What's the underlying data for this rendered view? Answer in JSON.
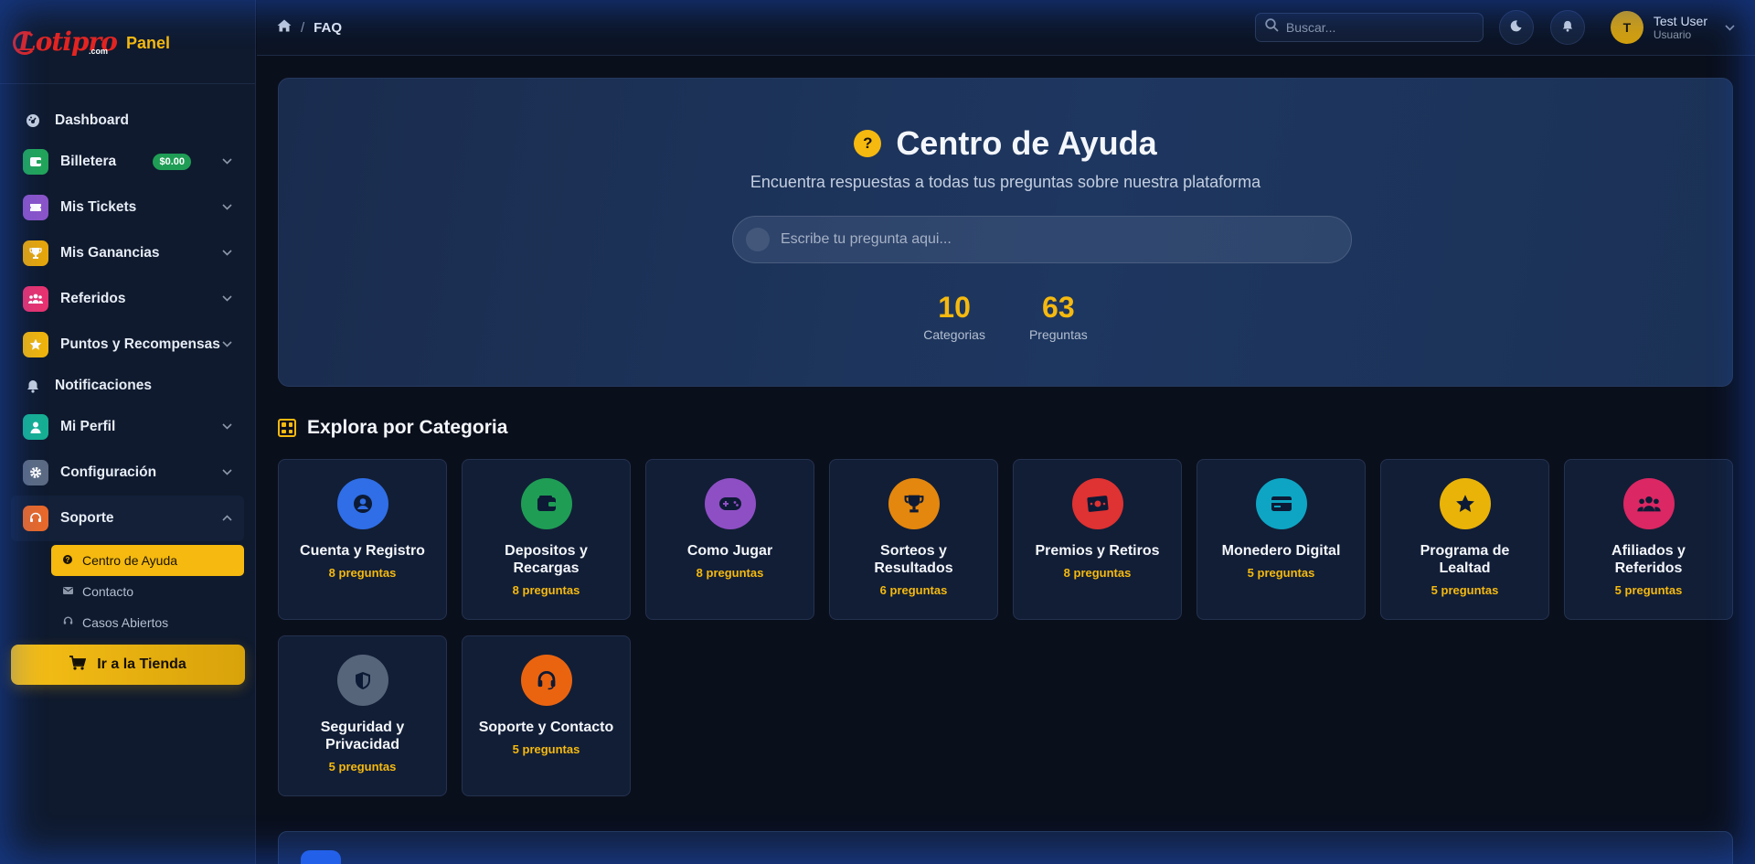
{
  "brand": {
    "logo_text": "Lotipro",
    "logo_suffix": ".com",
    "panel_label": "Panel"
  },
  "sidebar": {
    "items": [
      {
        "label": "Dashboard",
        "icon": "dashboard-icon"
      },
      {
        "label": "Billetera",
        "icon": "wallet-icon",
        "color": "#22a55a",
        "badge": "$0.00"
      },
      {
        "label": "Mis Tickets",
        "icon": "ticket-icon",
        "color": "#8b55c9"
      },
      {
        "label": "Mis Ganancias",
        "icon": "trophy-icon",
        "color": "#e6a60b"
      },
      {
        "label": "Referidos",
        "icon": "users-icon",
        "color": "#e8336f"
      },
      {
        "label": "Puntos y Recompensas",
        "icon": "star-icon",
        "color": "#f0b40c"
      },
      {
        "label": "Notificaciones",
        "icon": "bell-icon"
      },
      {
        "label": "Mi Perfil",
        "icon": "user-icon",
        "color": "#17b093"
      },
      {
        "label": "Configuración",
        "icon": "gear-icon",
        "color": "#5c6b82"
      },
      {
        "label": "Soporte",
        "icon": "headset-icon",
        "color": "#e8692a"
      }
    ],
    "support_sub": [
      {
        "label": "Centro de Ayuda",
        "icon": "question-icon",
        "active": true
      },
      {
        "label": "Contacto",
        "icon": "mail-icon"
      },
      {
        "label": "Casos Abiertos",
        "icon": "headset-icon"
      }
    ],
    "store_button": "Ir a la Tienda"
  },
  "topbar": {
    "breadcrumb_current": "FAQ",
    "search_placeholder": "Buscar...",
    "user_name": "Test User",
    "user_role": "Usuario",
    "avatar_initial": "T"
  },
  "hero": {
    "title": "Centro de Ayuda",
    "subtitle": "Encuentra respuestas a todas tus preguntas sobre nuestra plataforma",
    "search_placeholder": "Escribe tu pregunta aqui...",
    "stats": [
      {
        "value": "10",
        "label": "Categorias"
      },
      {
        "value": "63",
        "label": "Preguntas"
      }
    ]
  },
  "categories": {
    "title": "Explora por Categoria",
    "items": [
      {
        "name": "Cuenta y Registro",
        "count": "8 preguntas",
        "color": "#2f6ee6",
        "icon": "account-icon"
      },
      {
        "name": "Depositos y Recargas",
        "count": "8 preguntas",
        "color": "#1f9d55",
        "icon": "wallet-icon"
      },
      {
        "name": "Como Jugar",
        "count": "8 preguntas",
        "color": "#8e4fc4",
        "icon": "gamepad-icon"
      },
      {
        "name": "Sorteos y Resultados",
        "count": "6 preguntas",
        "color": "#e4870e",
        "icon": "trophy-icon"
      },
      {
        "name": "Premios y Retiros",
        "count": "8 preguntas",
        "color": "#df3232",
        "icon": "money-icon"
      },
      {
        "name": "Monedero Digital",
        "count": "5 preguntas",
        "color": "#0ea5c4",
        "icon": "card-icon"
      },
      {
        "name": "Programa de Lealtad",
        "count": "5 preguntas",
        "color": "#eab308",
        "icon": "star-icon"
      },
      {
        "name": "Afiliados y Referidos",
        "count": "5 preguntas",
        "color": "#db2763",
        "icon": "users-icon"
      },
      {
        "name": "Seguridad y Privacidad",
        "count": "5 preguntas",
        "color": "#56657a",
        "icon": "shield-icon"
      },
      {
        "name": "Soporte y Contacto",
        "count": "5 preguntas",
        "color": "#ea6410",
        "icon": "headset-icon"
      }
    ]
  }
}
